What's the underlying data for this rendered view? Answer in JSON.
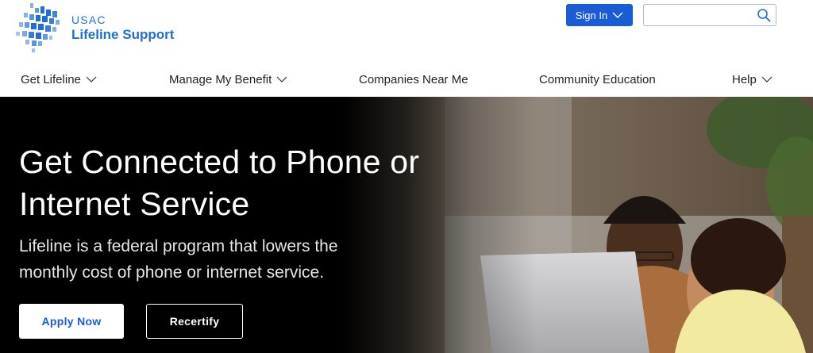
{
  "header": {
    "logo": {
      "org": "USAC",
      "name": "Lifeline Support"
    },
    "signin_label": "Sign In",
    "search": {
      "value": "",
      "placeholder": ""
    }
  },
  "nav": {
    "items": [
      {
        "label": "Get Lifeline",
        "has_dropdown": true
      },
      {
        "label": "Manage My Benefit",
        "has_dropdown": true
      },
      {
        "label": "Companies Near Me",
        "has_dropdown": false
      },
      {
        "label": "Community Education",
        "has_dropdown": false
      },
      {
        "label": "Help",
        "has_dropdown": true
      }
    ]
  },
  "hero": {
    "title": "Get Connected to Phone or Internet Service",
    "subtitle": "Lifeline is a federal program that lowers the monthly cost of phone or internet service.",
    "apply_label": "Apply Now",
    "recertify_label": "Recertify"
  },
  "icons": {
    "search": "search-icon",
    "chevron": "chevron-down-icon",
    "logo": "usac-logo-icon"
  },
  "colors": {
    "brand_blue": "#1a5bd8",
    "logo_blue": "#1f6fd6",
    "hero_bg": "#000000"
  }
}
